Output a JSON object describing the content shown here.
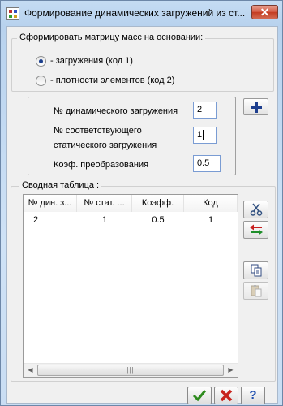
{
  "window": {
    "title": "Формирование динамических загружений из ст...",
    "close_label": "✕"
  },
  "mass_group": {
    "title": "Сформировать матрицу масс на основании:",
    "options": [
      {
        "label": "- загружения (код 1)",
        "selected": true
      },
      {
        "label": "- плотности элементов (код 2)",
        "selected": false
      }
    ]
  },
  "params": {
    "dyn_label": "№ динамического загружения",
    "dyn_value": "2",
    "static_label_1": "№ соответствующего",
    "static_label_2": "статического загружения",
    "static_value": "1",
    "coef_label": "Коэф. преобразования",
    "coef_value": "0.5"
  },
  "summary": {
    "title": "Сводная таблица :",
    "columns": [
      "№ дин. з...",
      "№ стат. ...",
      "Коэфф.",
      "Код"
    ],
    "rows": [
      [
        "2",
        "1",
        "0.5",
        "1"
      ]
    ]
  },
  "icons": {
    "add": "plus-icon",
    "cut": "scissors-icon",
    "swap": "swap-arrows-icon",
    "copy": "copy-icon",
    "paste": "paste-icon",
    "ok": "check-icon",
    "cancel": "cross-icon",
    "help": "question-icon"
  },
  "colors": {
    "title_bar": "#c5dcf3",
    "close_button": "#c43c22",
    "ok_green": "#2e8b1e",
    "cancel_red": "#c8231c",
    "help_blue": "#1f4fb0"
  }
}
